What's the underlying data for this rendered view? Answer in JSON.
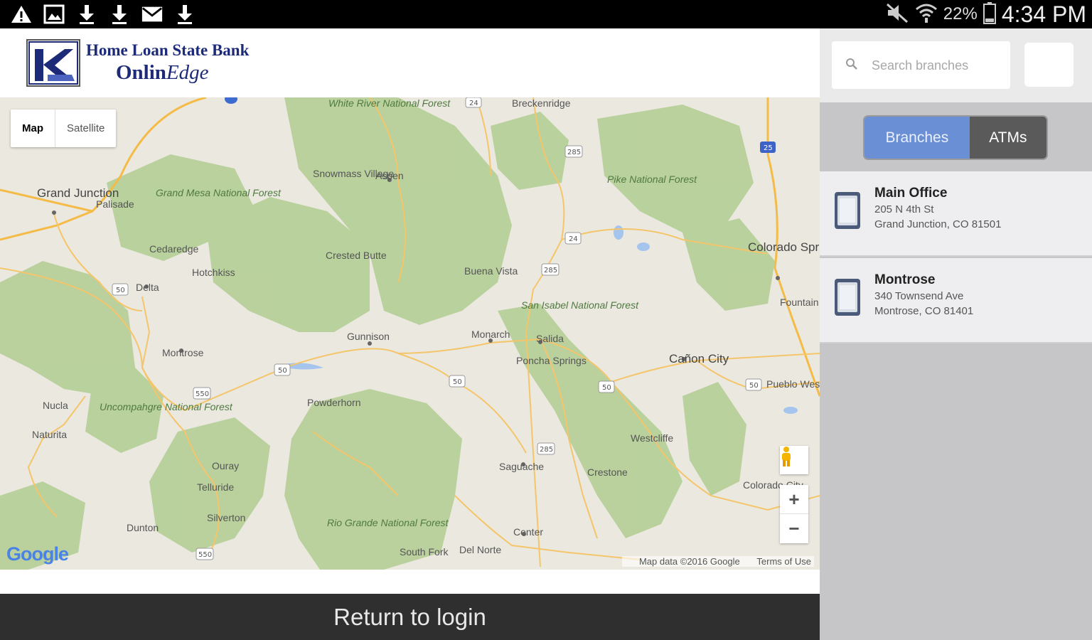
{
  "status_bar": {
    "icons": [
      "warning-icon",
      "image-icon",
      "download-icon",
      "download-icon",
      "mail-icon",
      "download-icon"
    ],
    "battery_percent": "22%",
    "time": "4:34 PM"
  },
  "header": {
    "bank_name": "Home Loan State Bank",
    "product_name_plain": "Onlin",
    "product_name_italic": "Edge",
    "brand_color": "#1c2a78"
  },
  "map": {
    "type_buttons": [
      "Map",
      "Satellite"
    ],
    "selected_type": "Map",
    "zoom_in": "+",
    "zoom_out": "−",
    "google_logo": "Google",
    "attribution": "Map data ©2016 Google",
    "terms": "Terms of Use",
    "places": [
      "Grand Junction",
      "Palisade",
      "Cedaredge",
      "Hotchkiss",
      "Delta",
      "Montrose",
      "Nucla",
      "Naturita",
      "Ouray",
      "Telluride",
      "Silverton",
      "Dunton",
      "Snowmass Village",
      "Aspen",
      "Crested Butte",
      "Gunnison",
      "Powderhorn",
      "Buena Vista",
      "Monarch",
      "Salida",
      "Poncha Springs",
      "Saguache",
      "Crestone",
      "Center",
      "South Fork",
      "Del Norte",
      "Westcliffe",
      "Cañon City",
      "Colorado Springs",
      "Fountain",
      "Pueblo West",
      "Breckenridge",
      "Colorado City"
    ],
    "forests": [
      "White River National Forest",
      "Grand Mesa National Forest",
      "Uncompahgre National Forest",
      "Pike National Forest",
      "San Isabel National Forest",
      "Rio Grande National Forest"
    ]
  },
  "sidebar": {
    "search_placeholder": "Search branches",
    "segments": [
      "Branches",
      "ATMs"
    ],
    "selected_segment": "Branches",
    "branches": [
      {
        "name": "Main Office",
        "address1": "205 N 4th St",
        "address2": "Grand Junction, CO 81501"
      },
      {
        "name": "Montrose",
        "address1": "340 Townsend Ave",
        "address2": "Montrose, CO 81401"
      }
    ]
  },
  "footer": {
    "return_label": "Return to login"
  }
}
